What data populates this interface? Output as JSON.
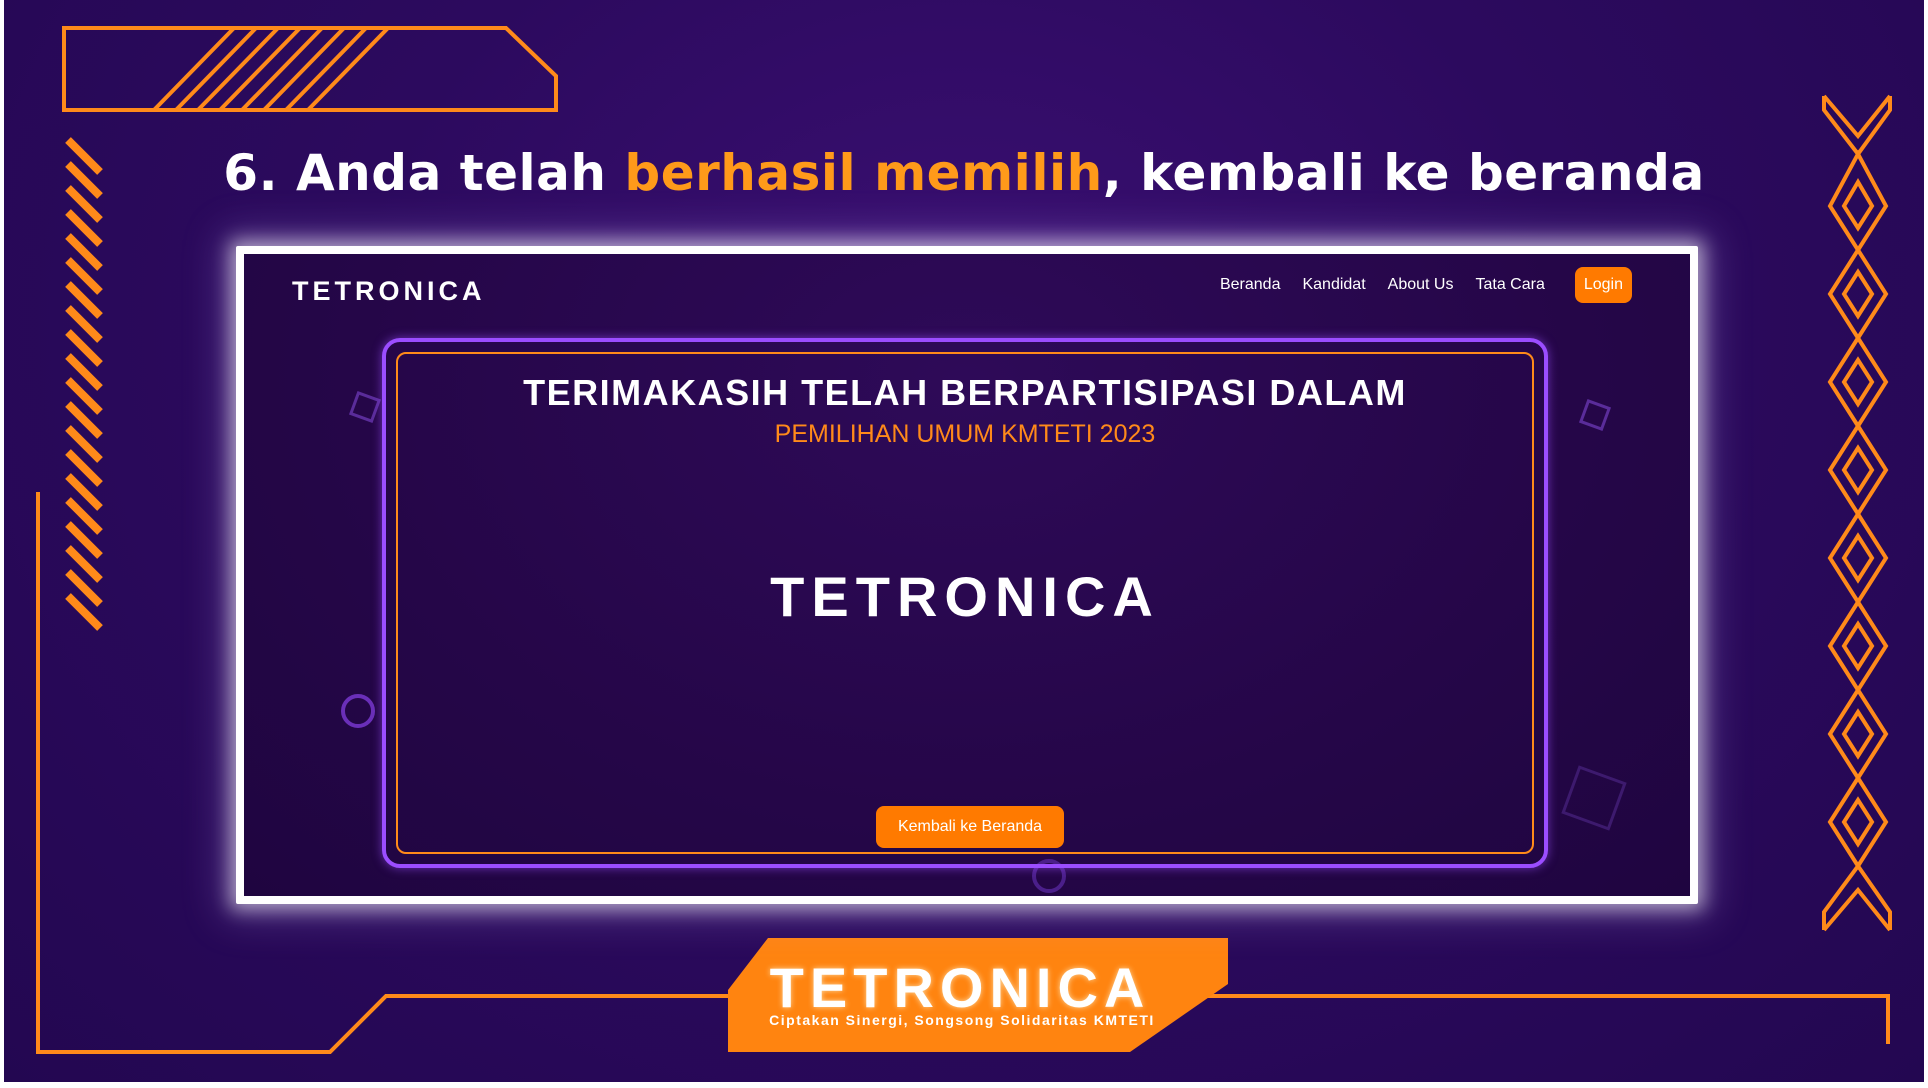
{
  "slide": {
    "heading_prefix": "6. Anda telah ",
    "heading_highlight": "berhasil memilih",
    "heading_suffix": ", kembali ke beranda"
  },
  "screenshot": {
    "nav": {
      "logo": "TETRONICA",
      "links": [
        "Beranda",
        "Kandidat",
        "About Us",
        "Tata Cara"
      ],
      "login": "Login"
    },
    "card": {
      "title": "TERIMAKASIH TELAH BERPARTISIPASI DALAM",
      "subtitle": "PEMILIHAN UMUM KMTETI 2023",
      "logo": "TETRONICA",
      "button": "Kembali ke Beranda"
    }
  },
  "banner": {
    "logo": "TETRONICA",
    "tagline": "Ciptakan Sinergi, Songsong Solidaritas KMTETI"
  },
  "colors": {
    "background": "#2c0a5e",
    "accent": "#ff8a1a",
    "button": "#ff7a00",
    "card_border": "#9b4dff",
    "text": "#ffffff"
  }
}
